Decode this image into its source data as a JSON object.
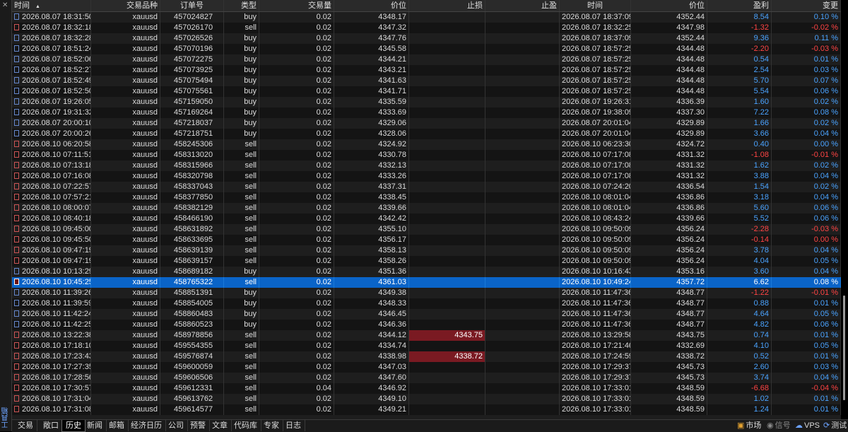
{
  "sidebar": {
    "close_glyph": "✕",
    "label": "工具箱"
  },
  "header": {
    "columns": [
      "时间",
      "交易品种",
      "订单号",
      "类型",
      "交易量",
      "价位",
      "止损",
      "止盈",
      "时间",
      "价位",
      "盈利",
      "变更"
    ],
    "sort_glyph": "▲"
  },
  "colors": {
    "selected_row": "#0a64c8",
    "profit": "#4aa3ff",
    "loss": "#ff4444",
    "sl_hit": "#7a1a22"
  },
  "rows": [
    {
      "open_time": "2026.08.07 18:31:50",
      "symbol": "xauusd",
      "ticket": "457024827",
      "type": "buy",
      "volume": "0.02",
      "open_price": "4348.17",
      "sl": "",
      "tp": "",
      "close_time": "2026.08.07 18:37:09",
      "close_price": "4352.44",
      "profit": "8.54",
      "change": "0.10 %"
    },
    {
      "open_time": "2026.08.07 18:32:18",
      "symbol": "xauusd",
      "ticket": "457026170",
      "type": "sell",
      "volume": "0.02",
      "open_price": "4347.32",
      "sl": "",
      "tp": "",
      "close_time": "2026.08.07 18:32:25",
      "close_price": "4347.98",
      "profit": "-1.32",
      "change": "-0.02 %"
    },
    {
      "open_time": "2026.08.07 18:32:28",
      "symbol": "xauusd",
      "ticket": "457026526",
      "type": "buy",
      "volume": "0.02",
      "open_price": "4347.76",
      "sl": "",
      "tp": "",
      "close_time": "2026.08.07 18:37:09",
      "close_price": "4352.44",
      "profit": "9.36",
      "change": "0.11 %"
    },
    {
      "open_time": "2026.08.07 18:51:24",
      "symbol": "xauusd",
      "ticket": "457070196",
      "type": "buy",
      "volume": "0.02",
      "open_price": "4345.58",
      "sl": "",
      "tp": "",
      "close_time": "2026.08.07 18:57:25",
      "close_price": "4344.48",
      "profit": "-2.20",
      "change": "-0.03 %"
    },
    {
      "open_time": "2026.08.07 18:52:06",
      "symbol": "xauusd",
      "ticket": "457072275",
      "type": "buy",
      "volume": "0.02",
      "open_price": "4344.21",
      "sl": "",
      "tp": "",
      "close_time": "2026.08.07 18:57:25",
      "close_price": "4344.48",
      "profit": "0.54",
      "change": "0.01 %"
    },
    {
      "open_time": "2026.08.07 18:52:27",
      "symbol": "xauusd",
      "ticket": "457073925",
      "type": "buy",
      "volume": "0.02",
      "open_price": "4343.21",
      "sl": "",
      "tp": "",
      "close_time": "2026.08.07 18:57:25",
      "close_price": "4344.48",
      "profit": "2.54",
      "change": "0.03 %"
    },
    {
      "open_time": "2026.08.07 18:52:49",
      "symbol": "xauusd",
      "ticket": "457075494",
      "type": "buy",
      "volume": "0.02",
      "open_price": "4341.63",
      "sl": "",
      "tp": "",
      "close_time": "2026.08.07 18:57:25",
      "close_price": "4344.48",
      "profit": "5.70",
      "change": "0.07 %"
    },
    {
      "open_time": "2026.08.07 18:52:50",
      "symbol": "xauusd",
      "ticket": "457075561",
      "type": "buy",
      "volume": "0.02",
      "open_price": "4341.71",
      "sl": "",
      "tp": "",
      "close_time": "2026.08.07 18:57:25",
      "close_price": "4344.48",
      "profit": "5.54",
      "change": "0.06 %"
    },
    {
      "open_time": "2026.08.07 19:26:05",
      "symbol": "xauusd",
      "ticket": "457159050",
      "type": "buy",
      "volume": "0.02",
      "open_price": "4335.59",
      "sl": "",
      "tp": "",
      "close_time": "2026.08.07 19:26:31",
      "close_price": "4336.39",
      "profit": "1.60",
      "change": "0.02 %"
    },
    {
      "open_time": "2026.08.07 19:31:32",
      "symbol": "xauusd",
      "ticket": "457169264",
      "type": "buy",
      "volume": "0.02",
      "open_price": "4333.69",
      "sl": "",
      "tp": "",
      "close_time": "2026.08.07 19:38:09",
      "close_price": "4337.30",
      "profit": "7.22",
      "change": "0.08 %"
    },
    {
      "open_time": "2026.08.07 20:00:10",
      "symbol": "xauusd",
      "ticket": "457218037",
      "type": "buy",
      "volume": "0.02",
      "open_price": "4329.06",
      "sl": "",
      "tp": "",
      "close_time": "2026.08.07 20:01:04",
      "close_price": "4329.89",
      "profit": "1.66",
      "change": "0.02 %"
    },
    {
      "open_time": "2026.08.07 20:00:26",
      "symbol": "xauusd",
      "ticket": "457218751",
      "type": "buy",
      "volume": "0.02",
      "open_price": "4328.06",
      "sl": "",
      "tp": "",
      "close_time": "2026.08.07 20:01:04",
      "close_price": "4329.89",
      "profit": "3.66",
      "change": "0.04 %"
    },
    {
      "open_time": "2026.08.10 06:20:58",
      "symbol": "xauusd",
      "ticket": "458245306",
      "type": "sell",
      "volume": "0.02",
      "open_price": "4324.92",
      "sl": "",
      "tp": "",
      "close_time": "2026.08.10 06:23:30",
      "close_price": "4324.72",
      "profit": "0.40",
      "change": "0.00 %"
    },
    {
      "open_time": "2026.08.10 07:11:51",
      "symbol": "xauusd",
      "ticket": "458313020",
      "type": "sell",
      "volume": "0.02",
      "open_price": "4330.78",
      "sl": "",
      "tp": "",
      "close_time": "2026.08.10 07:17:08",
      "close_price": "4331.32",
      "profit": "-1.08",
      "change": "-0.01 %"
    },
    {
      "open_time": "2026.08.10 07:13:18",
      "symbol": "xauusd",
      "ticket": "458315966",
      "type": "sell",
      "volume": "0.02",
      "open_price": "4332.13",
      "sl": "",
      "tp": "",
      "close_time": "2026.08.10 07:17:08",
      "close_price": "4331.32",
      "profit": "1.62",
      "change": "0.02 %"
    },
    {
      "open_time": "2026.08.10 07:16:08",
      "symbol": "xauusd",
      "ticket": "458320798",
      "type": "sell",
      "volume": "0.02",
      "open_price": "4333.26",
      "sl": "",
      "tp": "",
      "close_time": "2026.08.10 07:17:08",
      "close_price": "4331.32",
      "profit": "3.88",
      "change": "0.04 %"
    },
    {
      "open_time": "2026.08.10 07:22:57",
      "symbol": "xauusd",
      "ticket": "458337043",
      "type": "sell",
      "volume": "0.02",
      "open_price": "4337.31",
      "sl": "",
      "tp": "",
      "close_time": "2026.08.10 07:24:20",
      "close_price": "4336.54",
      "profit": "1.54",
      "change": "0.02 %"
    },
    {
      "open_time": "2026.08.10 07:57:21",
      "symbol": "xauusd",
      "ticket": "458377850",
      "type": "sell",
      "volume": "0.02",
      "open_price": "4338.45",
      "sl": "",
      "tp": "",
      "close_time": "2026.08.10 08:01:04",
      "close_price": "4336.86",
      "profit": "3.18",
      "change": "0.04 %"
    },
    {
      "open_time": "2026.08.10 08:00:07",
      "symbol": "xauusd",
      "ticket": "458382129",
      "type": "sell",
      "volume": "0.02",
      "open_price": "4339.66",
      "sl": "",
      "tp": "",
      "close_time": "2026.08.10 08:01:04",
      "close_price": "4336.86",
      "profit": "5.60",
      "change": "0.06 %"
    },
    {
      "open_time": "2026.08.10 08:40:18",
      "symbol": "xauusd",
      "ticket": "458466190",
      "type": "sell",
      "volume": "0.02",
      "open_price": "4342.42",
      "sl": "",
      "tp": "",
      "close_time": "2026.08.10 08:43:24",
      "close_price": "4339.66",
      "profit": "5.52",
      "change": "0.06 %"
    },
    {
      "open_time": "2026.08.10 09:45:00",
      "symbol": "xauusd",
      "ticket": "458631892",
      "type": "sell",
      "volume": "0.02",
      "open_price": "4355.10",
      "sl": "",
      "tp": "",
      "close_time": "2026.08.10 09:50:09",
      "close_price": "4356.24",
      "profit": "-2.28",
      "change": "-0.03 %"
    },
    {
      "open_time": "2026.08.10 09:45:50",
      "symbol": "xauusd",
      "ticket": "458633695",
      "type": "sell",
      "volume": "0.02",
      "open_price": "4356.17",
      "sl": "",
      "tp": "",
      "close_time": "2026.08.10 09:50:09",
      "close_price": "4356.24",
      "profit": "-0.14",
      "change": "0.00 %"
    },
    {
      "open_time": "2026.08.10 09:47:19",
      "symbol": "xauusd",
      "ticket": "458639139",
      "type": "sell",
      "volume": "0.02",
      "open_price": "4358.13",
      "sl": "",
      "tp": "",
      "close_time": "2026.08.10 09:50:09",
      "close_price": "4356.24",
      "profit": "3.78",
      "change": "0.04 %"
    },
    {
      "open_time": "2026.08.10 09:47:19",
      "symbol": "xauusd",
      "ticket": "458639157",
      "type": "sell",
      "volume": "0.02",
      "open_price": "4358.26",
      "sl": "",
      "tp": "",
      "close_time": "2026.08.10 09:50:09",
      "close_price": "4356.24",
      "profit": "4.04",
      "change": "0.05 %"
    },
    {
      "open_time": "2026.08.10 10:13:29",
      "symbol": "xauusd",
      "ticket": "458689182",
      "type": "buy",
      "volume": "0.02",
      "open_price": "4351.36",
      "sl": "",
      "tp": "",
      "close_time": "2026.08.10 10:16:43",
      "close_price": "4353.16",
      "profit": "3.60",
      "change": "0.04 %"
    },
    {
      "open_time": "2026.08.10 10:45:25",
      "symbol": "xauusd",
      "ticket": "458765322",
      "type": "sell",
      "volume": "0.02",
      "open_price": "4361.03",
      "sl": "",
      "tp": "",
      "close_time": "2026.08.10 10:49:24",
      "close_price": "4357.72",
      "profit": "6.62",
      "change": "0.08 %",
      "selected": true
    },
    {
      "open_time": "2026.08.10 11:39:26",
      "symbol": "xauusd",
      "ticket": "458851391",
      "type": "buy",
      "volume": "0.02",
      "open_price": "4349.38",
      "sl": "",
      "tp": "",
      "close_time": "2026.08.10 11:47:36",
      "close_price": "4348.77",
      "profit": "-1.22",
      "change": "-0.01 %"
    },
    {
      "open_time": "2026.08.10 11:39:59",
      "symbol": "xauusd",
      "ticket": "458854005",
      "type": "buy",
      "volume": "0.02",
      "open_price": "4348.33",
      "sl": "",
      "tp": "",
      "close_time": "2026.08.10 11:47:36",
      "close_price": "4348.77",
      "profit": "0.88",
      "change": "0.01 %"
    },
    {
      "open_time": "2026.08.10 11:42:24",
      "symbol": "xauusd",
      "ticket": "458860483",
      "type": "buy",
      "volume": "0.02",
      "open_price": "4346.45",
      "sl": "",
      "tp": "",
      "close_time": "2026.08.10 11:47:36",
      "close_price": "4348.77",
      "profit": "4.64",
      "change": "0.05 %"
    },
    {
      "open_time": "2026.08.10 11:42:25",
      "symbol": "xauusd",
      "ticket": "458860523",
      "type": "buy",
      "volume": "0.02",
      "open_price": "4346.36",
      "sl": "",
      "tp": "",
      "close_time": "2026.08.10 11:47:36",
      "close_price": "4348.77",
      "profit": "4.82",
      "change": "0.06 %"
    },
    {
      "open_time": "2026.08.10 13:22:38",
      "symbol": "xauusd",
      "ticket": "458978856",
      "type": "sell",
      "volume": "0.02",
      "open_price": "4344.12",
      "sl": "4343.75",
      "tp": "",
      "close_time": "2026.08.10 13:29:58",
      "close_price": "4343.75",
      "profit": "0.74",
      "change": "0.01 %",
      "sl_hit": true
    },
    {
      "open_time": "2026.08.10 17:18:10",
      "symbol": "xauusd",
      "ticket": "459554355",
      "type": "sell",
      "volume": "0.02",
      "open_price": "4334.74",
      "sl": "",
      "tp": "",
      "close_time": "2026.08.10 17:21:46",
      "close_price": "4332.69",
      "profit": "4.10",
      "change": "0.05 %"
    },
    {
      "open_time": "2026.08.10 17:23:43",
      "symbol": "xauusd",
      "ticket": "459576874",
      "type": "sell",
      "volume": "0.02",
      "open_price": "4338.98",
      "sl": "4338.72",
      "tp": "",
      "close_time": "2026.08.10 17:24:59",
      "close_price": "4338.72",
      "profit": "0.52",
      "change": "0.01 %",
      "sl_hit": true
    },
    {
      "open_time": "2026.08.10 17:27:35",
      "symbol": "xauusd",
      "ticket": "459600059",
      "type": "sell",
      "volume": "0.02",
      "open_price": "4347.03",
      "sl": "",
      "tp": "",
      "close_time": "2026.08.10 17:29:37",
      "close_price": "4345.73",
      "profit": "2.60",
      "change": "0.03 %"
    },
    {
      "open_time": "2026.08.10 17:28:56",
      "symbol": "xauusd",
      "ticket": "459606506",
      "type": "sell",
      "volume": "0.02",
      "open_price": "4347.60",
      "sl": "",
      "tp": "",
      "close_time": "2026.08.10 17:29:37",
      "close_price": "4345.73",
      "profit": "3.74",
      "change": "0.04 %"
    },
    {
      "open_time": "2026.08.10 17:30:57",
      "symbol": "xauusd",
      "ticket": "459612331",
      "type": "sell",
      "volume": "0.04",
      "open_price": "4346.92",
      "sl": "",
      "tp": "",
      "close_time": "2026.08.10 17:33:01",
      "close_price": "4348.59",
      "profit": "-6.68",
      "change": "-0.04 %"
    },
    {
      "open_time": "2026.08.10 17:31:04",
      "symbol": "xauusd",
      "ticket": "459613762",
      "type": "sell",
      "volume": "0.02",
      "open_price": "4349.10",
      "sl": "",
      "tp": "",
      "close_time": "2026.08.10 17:33:01",
      "close_price": "4348.59",
      "profit": "1.02",
      "change": "0.01 %"
    },
    {
      "open_time": "2026.08.10 17:31:08",
      "symbol": "xauusd",
      "ticket": "459614577",
      "type": "sell",
      "volume": "0.02",
      "open_price": "4349.21",
      "sl": "",
      "tp": "",
      "close_time": "2026.08.10 17:33:01",
      "close_price": "4348.59",
      "profit": "1.24",
      "change": "0.01 %"
    }
  ],
  "tabs": [
    {
      "label": "交易"
    },
    {
      "label": "敞口"
    },
    {
      "label": "历史",
      "active": true
    },
    {
      "label": "新闻"
    },
    {
      "label": "邮箱"
    },
    {
      "label": "经济日历"
    },
    {
      "label": "公司"
    },
    {
      "label": "预警"
    },
    {
      "label": "文章"
    },
    {
      "label": "代码库"
    },
    {
      "label": "专家"
    },
    {
      "label": "日志"
    }
  ],
  "status": {
    "market": "市场",
    "signals": "信号",
    "vps": "VPS",
    "tester": "测试"
  }
}
